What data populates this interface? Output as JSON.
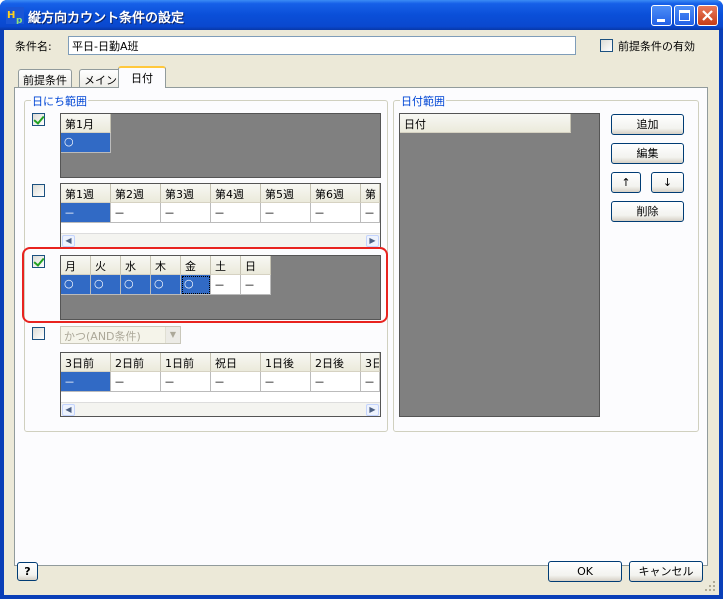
{
  "window": {
    "title": "縦方向カウント条件の設定"
  },
  "condition_name": {
    "label": "条件名:",
    "value": "平日-日勤A班"
  },
  "prereq_enabled": {
    "label": "前提条件の有効",
    "checked": false
  },
  "tabs": [
    {
      "label": "前提条件"
    },
    {
      "label": "メイン"
    },
    {
      "label": "日付",
      "active": true
    }
  ],
  "date_range_group": {
    "title": "日にち範囲"
  },
  "month_grid": {
    "enabled": true,
    "headers": [
      "第1月"
    ],
    "values": [
      "○"
    ]
  },
  "week_grid": {
    "enabled": false,
    "headers": [
      "第1週",
      "第2週",
      "第3週",
      "第4週",
      "第5週",
      "第6週",
      "第"
    ],
    "values": [
      "－",
      "－",
      "－",
      "－",
      "－",
      "－",
      "－"
    ]
  },
  "weekday_grid": {
    "enabled": true,
    "headers": [
      "月",
      "火",
      "水",
      "木",
      "金",
      "土",
      "日"
    ],
    "values": [
      "○",
      "○",
      "○",
      "○",
      "○",
      "－",
      "－"
    ]
  },
  "relative_grid": {
    "enabled": false,
    "combo": "かつ(AND条件)",
    "headers": [
      "3日前",
      "2日前",
      "1日前",
      "祝日",
      "1日後",
      "2日後",
      "3日"
    ],
    "values": [
      "－",
      "－",
      "－",
      "－",
      "－",
      "－",
      "－"
    ]
  },
  "date_list_group": {
    "title": "日付範囲",
    "header": "日付"
  },
  "side_buttons": {
    "add": "追加",
    "edit": "編集",
    "up": "↑",
    "down": "↓",
    "delete": "削除"
  },
  "footer": {
    "help": "?",
    "ok": "OK",
    "cancel": "キャンセル"
  },
  "colors": {
    "title_bar": "#0a4fd8",
    "selection": "#316ac5",
    "highlight": "#e8231f",
    "group_title": "#0046d5"
  }
}
